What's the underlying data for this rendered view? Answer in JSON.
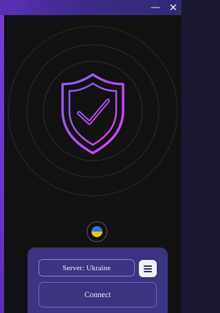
{
  "window": {
    "minimize_glyph": "—",
    "close_glyph": "✕"
  },
  "status": {
    "shield_icon": "shield-check-icon",
    "flag_icon": "ukraine-flag-icon"
  },
  "panel": {
    "server_label": "Server: Ukraine",
    "menu_icon": "hamburger-menu-icon",
    "connect_label": "Connect"
  },
  "colors": {
    "accent_purple": "#7a3bd6",
    "panel_bg": "#3b3480",
    "shield_gradient_start": "#8b5cf6",
    "shield_gradient_end": "#e040fb"
  }
}
